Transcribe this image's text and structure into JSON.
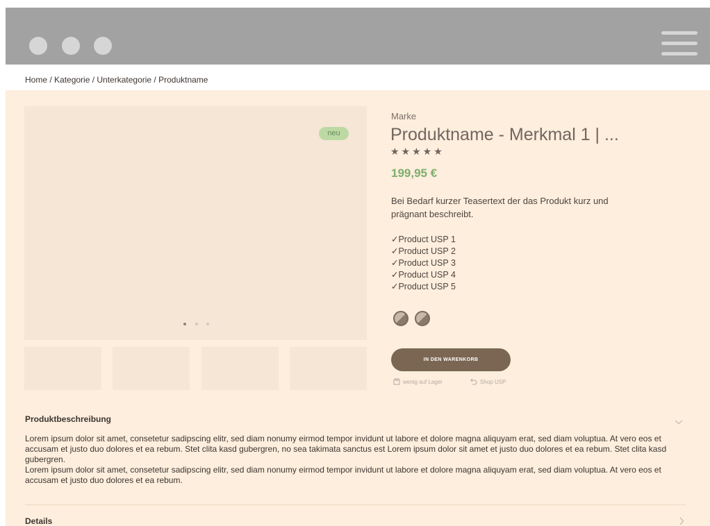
{
  "window": {
    "controls": [
      "dot",
      "dot",
      "dot"
    ],
    "menu_icon": "hamburger-menu-icon"
  },
  "breadcrumb": "Home / Kategorie / Unterkategorie / Produktname",
  "gallery": {
    "badge": "neu",
    "current_slide": 1,
    "slide_count": 3,
    "thumbnail_count": 4
  },
  "product": {
    "brand": "Marke",
    "title": "Produktname - Merkmal 1 | ...",
    "rating_stars": "★★★★★",
    "rating_value": 5,
    "price": "199,95 €",
    "teaser": "Bei Bedarf kurzer Teasertext der das Produkt kurz und prägnant beschreibt.",
    "usps": [
      "✓Product USP 1",
      "✓Product USP 2",
      "✓Product USP 3",
      "✓Product USP 4",
      "✓Product USP 5"
    ],
    "swatch_count": 2,
    "add_to_cart_label": "IN DEN WARENKORB",
    "stock_note": "wenig auf Lager",
    "shop_usp": "Shop USP"
  },
  "sections": {
    "description_title": "Produktbeschreibung",
    "description_paragraphs": [
      "Lorem ipsum dolor sit amet, consetetur sadipscing elitr, sed diam nonumy  eirmod tempor invidunt ut labore et dolore magna aliquyam erat, sed diam voluptua.  At vero eos et accusam et justo duo dolores et ea rebum. Stet clita kasd gubergren, no sea takimata sanctus est Lorem ipsum dolor sit amet  et justo duo dolores et ea rebum. Stet clita kasd gubergren.",
      "Lorem ipsum dolor sit amet, consetetur sadipscing elitr, sed diam nonumy  eirmod tempor invidunt ut labore et dolore magna aliquyam erat, sed diam voluptua.  At vero eos et accusam et justo duo dolores et ea rebum."
    ],
    "details_title": "Details"
  },
  "colors": {
    "topbar": "#a2a2a2",
    "background": "#fdeedd",
    "price": "#7fae6c",
    "badge": "#bcd9a4",
    "cart_button": "#7b6653"
  }
}
